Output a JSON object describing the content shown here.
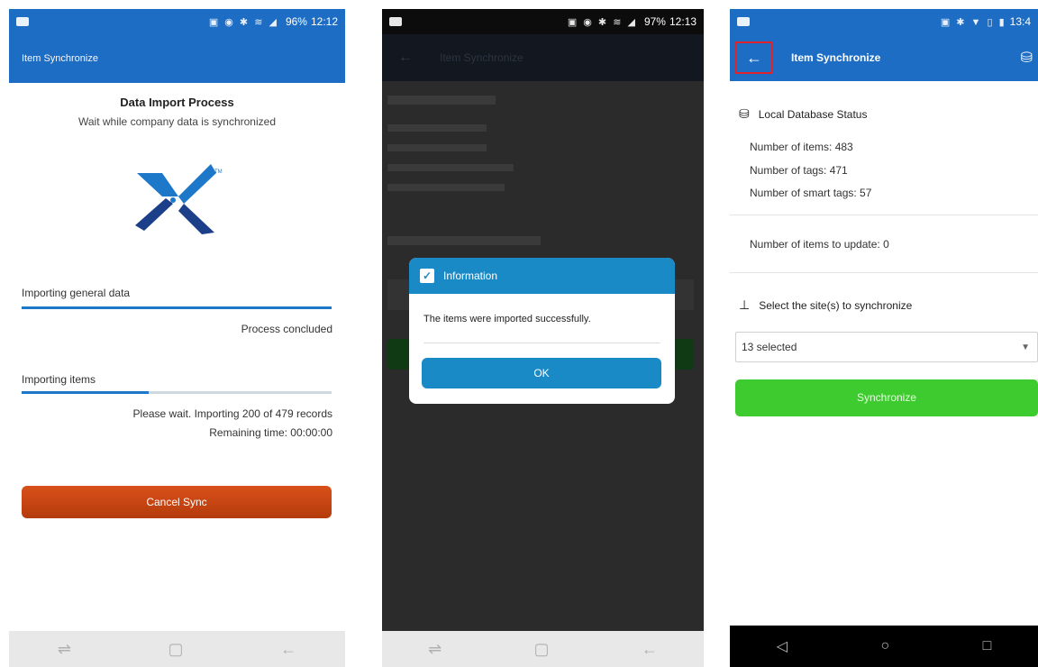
{
  "phone1": {
    "status": {
      "battery": "96%",
      "time": "12:12"
    },
    "appbar_title": "Item Synchronize",
    "heading": "Data Import Process",
    "subheading": "Wait while company data is synchronized",
    "general": {
      "label": "Importing general data",
      "progress": 1.0,
      "status": "Process concluded"
    },
    "items": {
      "label": "Importing items",
      "progress": 0.41,
      "status": "Please wait. Importing 200 of 479 records",
      "remaining": "Remaining time: 00:00:00"
    },
    "cancel_label": "Cancel Sync",
    "logo_color": "#1e78c9"
  },
  "phone2": {
    "status": {
      "battery": "97%",
      "time": "12:13"
    },
    "appbar_title": "Item Synchronize",
    "dialog": {
      "title": "Information",
      "message": "The items were imported successfully.",
      "ok_label": "OK"
    }
  },
  "phone3": {
    "status": {
      "time": "13:4"
    },
    "appbar_title": "Item Synchronize",
    "local_db_heading": "Local Database Status",
    "items_count": "Number of items: 483",
    "tags_count": "Number of tags: 471",
    "smart_tags_count": "Number of smart tags: 57",
    "items_to_update": "Number of items to update: 0",
    "sites_heading": "Select the site(s) to synchronize",
    "sites_selected": "13 selected",
    "sync_label": "Synchronize",
    "accent": "#1e6dc4",
    "sync_color": "#3ecb2f",
    "highlight_color": "#e0222c"
  }
}
